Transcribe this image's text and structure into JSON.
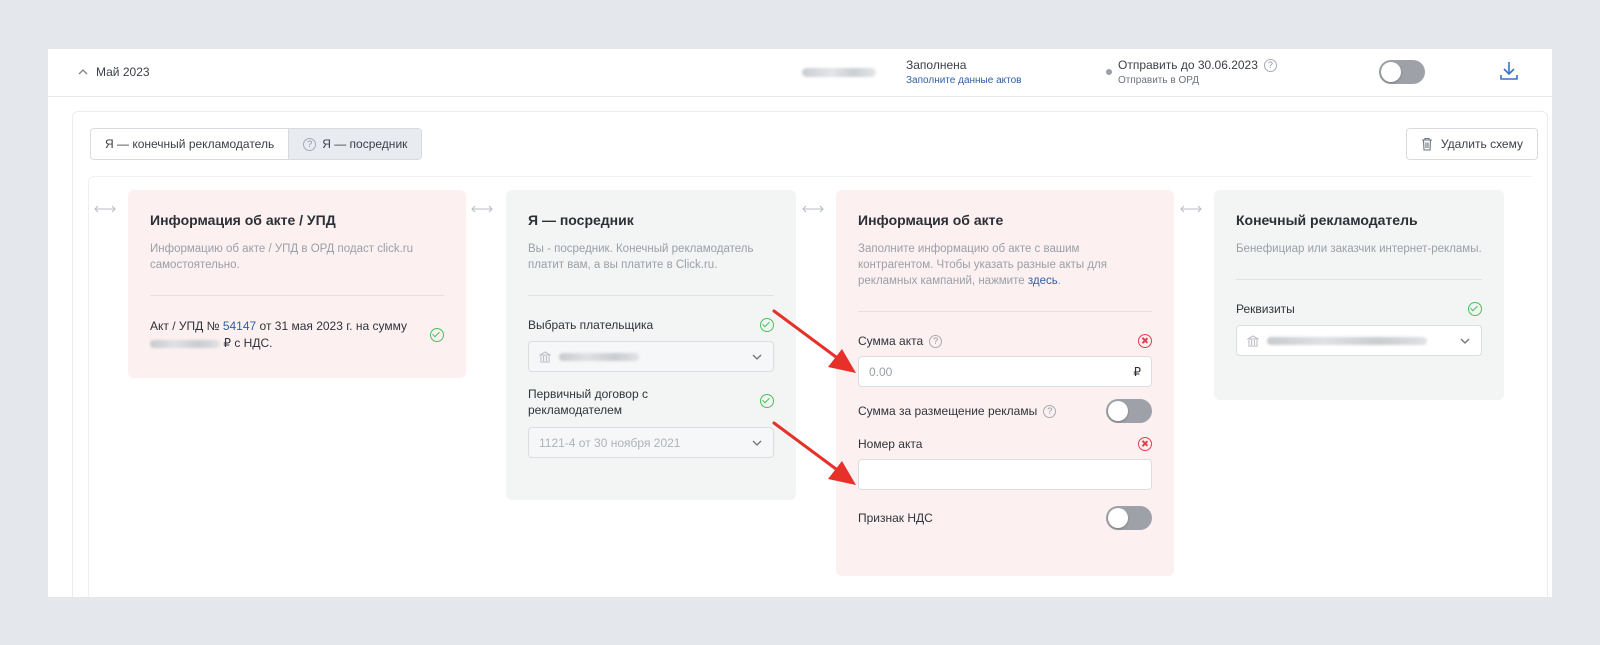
{
  "header": {
    "month": "Май 2023",
    "status_title": "Заполнена",
    "status_link": "Заполните данные актов",
    "send_title": "Отправить до 30.06.2023",
    "send_sub": "Отправить в ОРД",
    "help_mark": "?"
  },
  "tabs": {
    "final_advertiser": "Я — конечный рекламодатель",
    "intermediary": "Я — посредник"
  },
  "delete_scheme_label": "Удалить схему",
  "cards": {
    "act_upd": {
      "title": "Информация об акте / УПД",
      "description": "Информацию об акте / УПД в ОРД подаст click.ru самостоятельно.",
      "act_prefix": "Акт / УПД №",
      "act_number": "54147",
      "act_mid": "от 31 мая 2023 г. на сумму",
      "act_suffix": "₽ с НДС."
    },
    "intermediary": {
      "title": "Я — посредник",
      "description": "Вы - посредник. Конечный рекламодатель платит вам, а вы платите в Click.ru.",
      "payer_label": "Выбрать плательщика",
      "contract_label": "Первичный договор с рекламодателем",
      "contract_value": "1121-4 от 30 ноября 2021"
    },
    "act_info": {
      "title": "Информация об акте",
      "description": "Заполните информацию об акте с вашим контрагентом. Чтобы указать разные акты для рекламных кампаний, нажмите",
      "description_link": "здесь",
      "sum_label": "Сумма акта",
      "sum_placeholder": "0.00",
      "currency": "₽",
      "ad_sum_label": "Сумма за размещение рекламы",
      "act_number_label": "Номер акта",
      "vat_label": "Признак НДС"
    },
    "final_advertiser": {
      "title": "Конечный рекламодатель",
      "description": "Бенефициар или заказчик интернет-рекламы.",
      "requisites_label": "Реквизиты"
    }
  },
  "colors": {
    "link": "#2e5fa8",
    "ok": "#4cbf5a",
    "error": "#e0404a",
    "pink_card": "#fcf0f1",
    "gray_card": "#f3f5f4",
    "annotation_arrow": "#e8302a"
  },
  "icons": [
    "chevron-up-icon",
    "help-icon",
    "download-icon",
    "trash-icon",
    "swap-arrows-icon",
    "check-circle-icon",
    "error-circle-icon",
    "bank-icon",
    "chevron-down-icon"
  ]
}
